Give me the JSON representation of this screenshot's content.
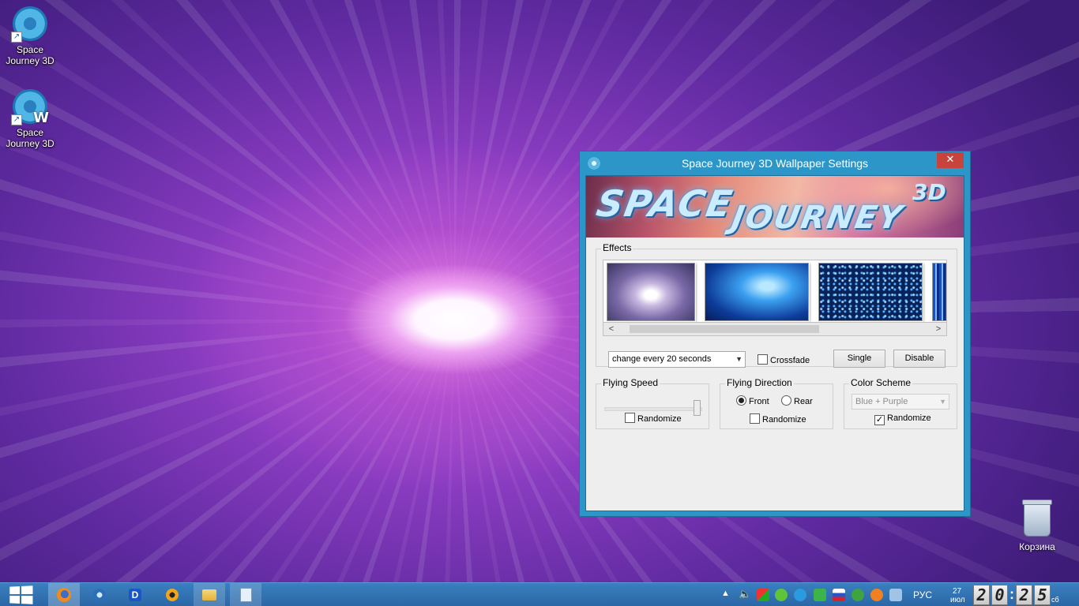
{
  "desktop": {
    "icons": [
      {
        "label": "Space Journey 3D"
      },
      {
        "label": "Space Journey 3D",
        "badge": "W"
      }
    ],
    "recycle_bin": {
      "label": "Корзина"
    }
  },
  "window": {
    "title": "Space Journey 3D  Wallpaper Settings",
    "close_glyph": "✕",
    "banner": {
      "word1": "SPACE",
      "word2": "JOURNEY",
      "suffix": "3D"
    },
    "effects": {
      "legend": "Effects",
      "thumbnails": [
        "effect-1",
        "effect-2",
        "effect-3",
        "effect-4"
      ],
      "scroll_left": "<",
      "scroll_right": ">",
      "interval_select": "change every 20 seconds",
      "crossfade_label": "Crossfade",
      "crossfade_checked": false,
      "single_button": "Single",
      "disable_button": "Disable"
    },
    "flying_speed": {
      "legend": "Flying Speed",
      "slider_level": 1.0,
      "randomize_label": "Randomize",
      "randomize_checked": false
    },
    "flying_direction": {
      "legend": "Flying Direction",
      "front_label": "Front",
      "rear_label": "Rear",
      "selected": "Front",
      "randomize_label": "Randomize",
      "randomize_checked": false
    },
    "color_scheme": {
      "legend": "Color Scheme",
      "select_value": "Blue + Purple",
      "randomize_label": "Randomize",
      "randomize_checked": true,
      "check_glyph": "✓"
    }
  },
  "taskbar": {
    "pinned": [
      "firefox-icon",
      "network-globe-icon",
      "media-d-icon",
      "aimp-icon",
      "file-explorer-icon",
      "notepad-icon"
    ],
    "tray": {
      "language": "РУС",
      "date_day": "27",
      "date_month": "июл",
      "clock_digits": [
        "2",
        "0",
        "2",
        "5"
      ],
      "weekday": "сб"
    }
  }
}
